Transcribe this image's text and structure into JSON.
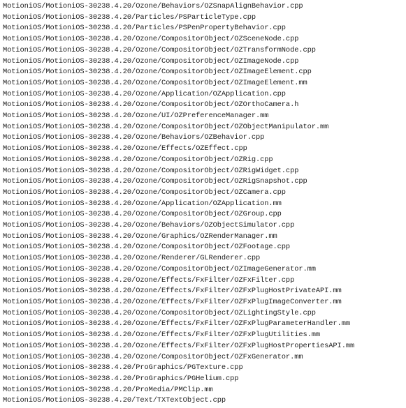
{
  "lines": [
    "MotioniOS/MotioniOS-30238.4.20/Ozone/Behaviors/OZSnapAlignBehavior.cpp",
    "MotioniOS/MotioniOS-30238.4.20/Particles/PSParticleType.cpp",
    "MotioniOS/MotioniOS-30238.4.20/Particles/PSPenPropertyBehavior.cpp",
    "MotioniOS/MotioniOS-30238.4.20/Ozone/CompositorObject/OZSceneNode.cpp",
    "MotioniOS/MotioniOS-30238.4.20/Ozone/CompositorObject/OZTransformNode.cpp",
    "MotioniOS/MotioniOS-30238.4.20/Ozone/CompositorObject/OZImageNode.cpp",
    "MotioniOS/MotioniOS-30238.4.20/Ozone/CompositorObject/OZImageElement.cpp",
    "MotioniOS/MotioniOS-30238.4.20/Ozone/CompositorObject/OZImageElement.mm",
    "MotioniOS/MotioniOS-30238.4.20/Ozone/Application/OZApplication.cpp",
    "MotioniOS/MotioniOS-30238.4.20/Ozone/CompositorObject/OZOrthoCamera.h",
    "MotioniOS/MotioniOS-30238.4.20/Ozone/UI/OZPreferenceManager.mm",
    "MotioniOS/MotioniOS-30238.4.20/Ozone/CompositorObject/OZObjectManipulator.mm",
    "MotioniOS/MotioniOS-30238.4.20/Ozone/Behaviors/OZBehavior.cpp",
    "MotioniOS/MotioniOS-30238.4.20/Ozone/Effects/OZEffect.cpp",
    "MotioniOS/MotioniOS-30238.4.20/Ozone/CompositorObject/OZRig.cpp",
    "MotioniOS/MotioniOS-30238.4.20/Ozone/CompositorObject/OZRigWidget.cpp",
    "MotioniOS/MotioniOS-30238.4.20/Ozone/CompositorObject/OZRigSnapshot.cpp",
    "MotioniOS/MotioniOS-30238.4.20/Ozone/CompositorObject/OZCamera.cpp",
    "MotioniOS/MotioniOS-30238.4.20/Ozone/Application/OZApplication.mm",
    "MotioniOS/MotioniOS-30238.4.20/Ozone/CompositorObject/OZGroup.cpp",
    "MotioniOS/MotioniOS-30238.4.20/Ozone/Behaviors/OZObjectSimulator.cpp",
    "MotioniOS/MotioniOS-30238.4.20/Ozone/Graphics/OZRenderManager.mm",
    "MotioniOS/MotioniOS-30238.4.20/Ozone/CompositorObject/OZFootage.cpp",
    "MotioniOS/MotioniOS-30238.4.20/Ozone/Renderer/GLRenderer.cpp",
    "MotioniOS/MotioniOS-30238.4.20/Ozone/CompositorObject/OZImageGenerator.mm",
    "MotioniOS/MotioniOS-30238.4.20/Ozone/Effects/FxFilter/OZFxFilter.cpp",
    "MotioniOS/MotioniOS-30238.4.20/Ozone/Effects/FxFilter/OZFxPlugHostPrivateAPI.mm",
    "MotioniOS/MotioniOS-30238.4.20/Ozone/Effects/FxFilter/OZFxPlugImageConverter.mm",
    "MotioniOS/MotioniOS-30238.4.20/Ozone/CompositorObject/OZLightingStyle.cpp",
    "MotioniOS/MotioniOS-30238.4.20/Ozone/Effects/FxFilter/OZFxPlugParameterHandler.mm",
    "MotioniOS/MotioniOS-30238.4.20/Ozone/Effects/FxFilter/OZFxPlugUtilities.mm",
    "MotioniOS/MotioniOS-30238.4.20/Ozone/Effects/FxFilter/OZFxPlugHostPropertiesAPI.mm",
    "MotioniOS/MotioniOS-30238.4.20/Ozone/CompositorObject/OZFxGenerator.mm",
    "MotioniOS/MotioniOS-30238.4.20/ProGraphics/PGTexture.cpp",
    "MotioniOS/MotioniOS-30238.4.20/ProGraphics/PGHelium.cpp",
    "MotioniOS/MotioniOS-30238.4.20/ProMedia/PMClip.mm",
    "MotioniOS/MotioniOS-30238.4.20/Text/TXTextObject.cpp"
  ]
}
